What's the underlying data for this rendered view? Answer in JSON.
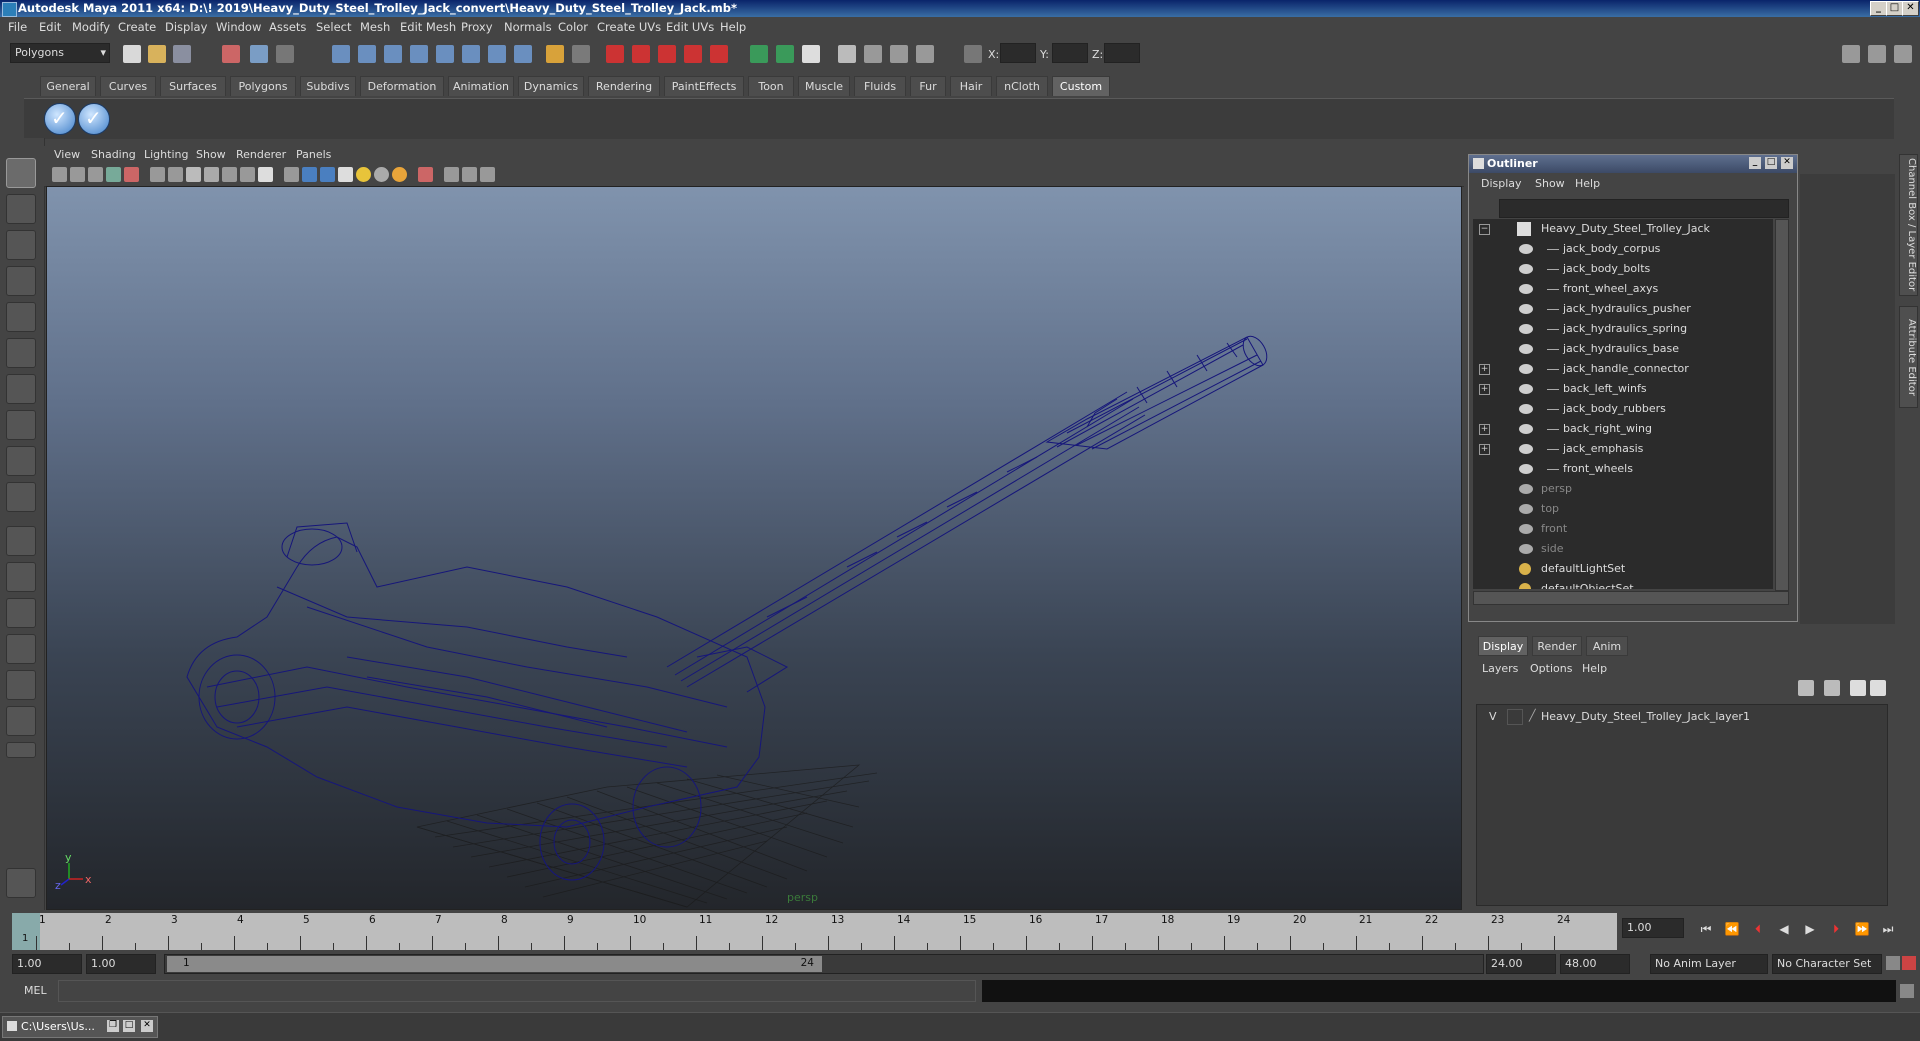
{
  "window": {
    "title": "Autodesk Maya 2011 x64: D:\\! 2019\\Heavy_Duty_Steel_Trolley_Jack_convert\\Heavy_Duty_Steel_Trolley_Jack.mb*",
    "buttons": [
      "_",
      "□",
      "✕"
    ]
  },
  "menubar": [
    "File",
    "Edit",
    "Modify",
    "Create",
    "Display",
    "Window",
    "Assets",
    "Select",
    "Mesh",
    "Edit Mesh",
    "Proxy",
    "Normals",
    "Color",
    "Create UVs",
    "Edit UVs",
    "Help"
  ],
  "statusline": {
    "mode": "Polygons",
    "x_label": "X:",
    "y_label": "Y:",
    "z_label": "Z:"
  },
  "shelf": {
    "tabs": [
      "General",
      "Curves",
      "Surfaces",
      "Polygons",
      "Subdivs",
      "Deformation",
      "Animation",
      "Dynamics",
      "Rendering",
      "PaintEffects",
      "Toon",
      "Muscle",
      "Fluids",
      "Fur",
      "Hair",
      "nCloth",
      "Custom"
    ],
    "active_tab": "Custom"
  },
  "viewport": {
    "menu": [
      "View",
      "Shading",
      "Lighting",
      "Show",
      "Renderer",
      "Panels"
    ],
    "camera_label": "persp",
    "axis": {
      "y": "y",
      "x": "x",
      "z": "z"
    },
    "wire_color": "#16167a"
  },
  "outliner": {
    "title": "Outliner",
    "menu": [
      "Display",
      "Show",
      "Help"
    ],
    "root": "Heavy_Duty_Steel_Trolley_Jack",
    "children": [
      {
        "name": "jack_body_corpus",
        "expandable": false
      },
      {
        "name": "jack_body_bolts",
        "expandable": false
      },
      {
        "name": "front_wheel_axys",
        "expandable": false
      },
      {
        "name": "jack_hydraulics_pusher",
        "expandable": false
      },
      {
        "name": "jack_hydraulics_spring",
        "expandable": false
      },
      {
        "name": "jack_hydraulics_base",
        "expandable": false
      },
      {
        "name": "jack_handle_connector",
        "expandable": true
      },
      {
        "name": "back_left_winfs",
        "expandable": true
      },
      {
        "name": "jack_body_rubbers",
        "expandable": false
      },
      {
        "name": "back_right_wing",
        "expandable": true
      },
      {
        "name": "jack_emphasis",
        "expandable": true
      },
      {
        "name": "front_wheels",
        "expandable": false
      }
    ],
    "cameras": [
      "persp",
      "top",
      "front",
      "side"
    ],
    "sets": [
      "defaultLightSet",
      "defaultObjectSet"
    ]
  },
  "layer_editor": {
    "tabs": [
      "Display",
      "Render",
      "Anim"
    ],
    "active_tab": "Display",
    "menu": [
      "Layers",
      "Options",
      "Help"
    ],
    "layers": [
      {
        "visible": "V",
        "name": "Heavy_Duty_Steel_Trolley_Jack_layer1"
      }
    ]
  },
  "side_tabs": [
    "Channel Box / Layer Editor",
    "Attribute Editor"
  ],
  "timeline": {
    "frames": [
      "1",
      "2",
      "3",
      "4",
      "5",
      "6",
      "7",
      "8",
      "9",
      "10",
      "11",
      "12",
      "13",
      "14",
      "15",
      "16",
      "17",
      "18",
      "19",
      "20",
      "21",
      "22",
      "23",
      "24"
    ],
    "current_frame_label": "1",
    "current_time": "1.00"
  },
  "range": {
    "start_time": "1.00",
    "playback_start": "1.00",
    "slider_start": "1",
    "slider_end": "24",
    "playback_end": "24.00",
    "end_time": "48.00",
    "anim_layer": "No Anim Layer",
    "character_set": "No Character Set"
  },
  "command_line": {
    "label": "MEL"
  },
  "taskbar": {
    "item": "C:\\Users\\Us..."
  }
}
